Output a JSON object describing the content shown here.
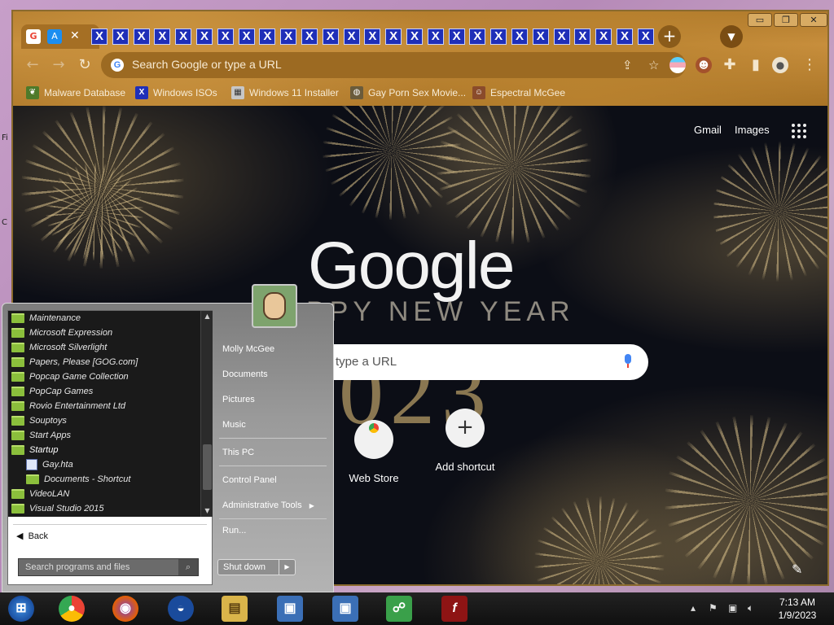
{
  "browser": {
    "tab_close_glyph": "✕",
    "repeated_tab_glyph": "X",
    "repeated_tab_count": 27,
    "window_buttons": {
      "minimize": "▭",
      "restore": "❐",
      "close": "✕"
    },
    "omnibox_placeholder": "Search Google or type a URL",
    "bookmarks": [
      {
        "label": "Malware Database",
        "icon": "leaf-icon",
        "color": "#4e7a2a"
      },
      {
        "label": "Windows ISOs",
        "icon": "x-icon",
        "color": "#1f2fb8"
      },
      {
        "label": "Windows 11 Installer",
        "icon": "installer-icon",
        "color": "#c7c7c7"
      },
      {
        "label": "Gay Porn Sex Movie...",
        "icon": "globe-icon",
        "color": "#6a5b3b"
      },
      {
        "label": "Espectral McGee",
        "icon": "avatar-icon",
        "color": "#8a4b2b"
      }
    ]
  },
  "ntp": {
    "gmail_label": "Gmail",
    "images_label": "Images",
    "logo_text": "Google",
    "banner_text": "PPY NEW YEAR",
    "year_text": "023",
    "search_placeholder": "type a URL",
    "shortcuts": [
      {
        "label": "Web Store",
        "icon": "webstore-icon"
      },
      {
        "label": "Add shortcut",
        "icon": "plus-icon",
        "glyph": "+"
      }
    ]
  },
  "start_menu": {
    "programs": [
      {
        "label": "Maintenance",
        "type": "folder"
      },
      {
        "label": "Microsoft Expression",
        "type": "folder"
      },
      {
        "label": "Microsoft Silverlight",
        "type": "folder"
      },
      {
        "label": "Papers, Please [GOG.com]",
        "type": "folder"
      },
      {
        "label": "Popcap Game Collection",
        "type": "folder"
      },
      {
        "label": "PopCap Games",
        "type": "folder"
      },
      {
        "label": "Rovio Entertainment Ltd",
        "type": "folder"
      },
      {
        "label": "Souptoys",
        "type": "folder"
      },
      {
        "label": "Start Apps",
        "type": "folder"
      },
      {
        "label": "Startup",
        "type": "folder",
        "selected": true
      },
      {
        "label": "Gay.hta",
        "type": "file",
        "sub": true
      },
      {
        "label": "Documents - Shortcut",
        "type": "folder",
        "sub": true
      },
      {
        "label": "VideoLAN",
        "type": "folder"
      },
      {
        "label": "Visual Studio 2015",
        "type": "folder"
      }
    ],
    "back_label": "Back",
    "search_placeholder": "Search programs and files",
    "right_items": [
      {
        "label": "Molly McGee"
      },
      {
        "label": "Documents"
      },
      {
        "label": "Pictures"
      },
      {
        "label": "Music"
      },
      {
        "label": "This PC"
      },
      {
        "label": "Control Panel"
      },
      {
        "label": "Administrative Tools",
        "submenu": true
      },
      {
        "label": "Run..."
      }
    ],
    "shutdown_label": "Shut down"
  },
  "taskbar": {
    "apps": [
      {
        "name": "start-button",
        "color": "#1f6fd1"
      },
      {
        "name": "chrome",
        "color": "#3a3a3a"
      },
      {
        "name": "firefox",
        "color": "#e66000"
      },
      {
        "name": "obama-logo",
        "color": "#1a4b9c"
      },
      {
        "name": "file-explorer",
        "color": "#d9b44a"
      },
      {
        "name": "remote-app-1",
        "color": "#3b6fb6"
      },
      {
        "name": "remote-app-2",
        "color": "#3b6fb6"
      },
      {
        "name": "messenger",
        "color": "#3aa04a"
      },
      {
        "name": "flash",
        "color": "#8e1414"
      }
    ],
    "time": "7:13 AM",
    "date": "1/9/2023"
  }
}
